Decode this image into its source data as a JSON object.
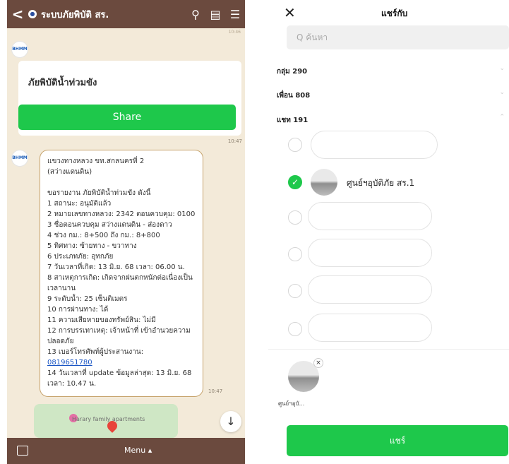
{
  "left_chat": {
    "header": {
      "back_glyph": "<",
      "official_glyph": "●",
      "title": "ระบบภัยพิบัติ สร.",
      "search_glyph": "⚲",
      "notes_glyph": "▤",
      "menu_glyph": "☰"
    },
    "tiny_time": "10:46",
    "avatar_text": "BHMM",
    "card": {
      "title": "ภัยพิบัติน้ำท่วมขัง",
      "share_label": "Share"
    },
    "time1": "10:47",
    "message": {
      "lines": [
        "แขวงทางหลวง ขท.สกลนครที่ 2",
        "(สว่างแดนดิน)",
        "",
        "ขอรายงาน ภัยพิบัติน้ำท่วมขัง ดังนี้",
        "1 สถานะ: อนุมัติแล้ว",
        "2 หมายเลขทางหลวง: 2342 ตอนควบคุม: 0100",
        "3 ชื่อตอนควบคุม สว่างแดนดิน - ส่องดาว",
        "4 ช่วง กม.: 8+500 ถึง กม.: 8+800",
        "5 ทิศทาง: ซ้ายทาง - ขวาทาง",
        "6 ประเภทภัย: อุทกภัย",
        "7 วันเวลาที่เกิด: 13 มิ.ย. 68 เวลา: 06.00 น.",
        "8 สาเหตุการเกิด: เกิดจากฝนตกหนักต่อเนื่องเป็นเวลานาน",
        "9 ระดับน้ำ: 25 เซ็นติเมตร",
        "10 การผ่านทาง: ได้",
        "11 ความเสียหายของทรัพย์สิน: ไม่มี",
        "12 การบรรเทาเหตุ: เจ้าหน้าที่ เข้าอำนวยความปลอดภัย",
        "13 เบอร์โทรศัพท์ผู้ประสานงาน:",
        "0819651780",
        "14 วันเวลาที่ update ข้อมูลล่าสุด: 13 มิ.ย. 68 เวลา: 10.47 น."
      ]
    },
    "time2": "10:47",
    "map_label": "Harary family apartments",
    "scroll_down_glyph": "↓",
    "footer": {
      "keyboard_glyph": "⌨",
      "menu_label": "Menu ▴"
    }
  },
  "share_panel": {
    "close_glyph": "✕",
    "title": "แชร์กับ",
    "search_placeholder": "Q ค้นหา",
    "groups_label": "กลุ่ม 290",
    "friends_label": "เพื่อน 808",
    "chats_label": "แชท 191",
    "chev_down": "⌄",
    "chev_up": "⌃",
    "selected_check": "✓",
    "selected_name": "ศูนย์ฯอุบัติภัย สร.1",
    "selection_remove_glyph": "×",
    "selection_name": "ศูนย์ฯอุบั...",
    "share_button": "แชร์"
  },
  "colors": {
    "header_brown": "#6b4a3e",
    "chat_bg": "#f3ead9",
    "accent_green": "#1ec84b",
    "link_blue": "#1a55c4"
  }
}
